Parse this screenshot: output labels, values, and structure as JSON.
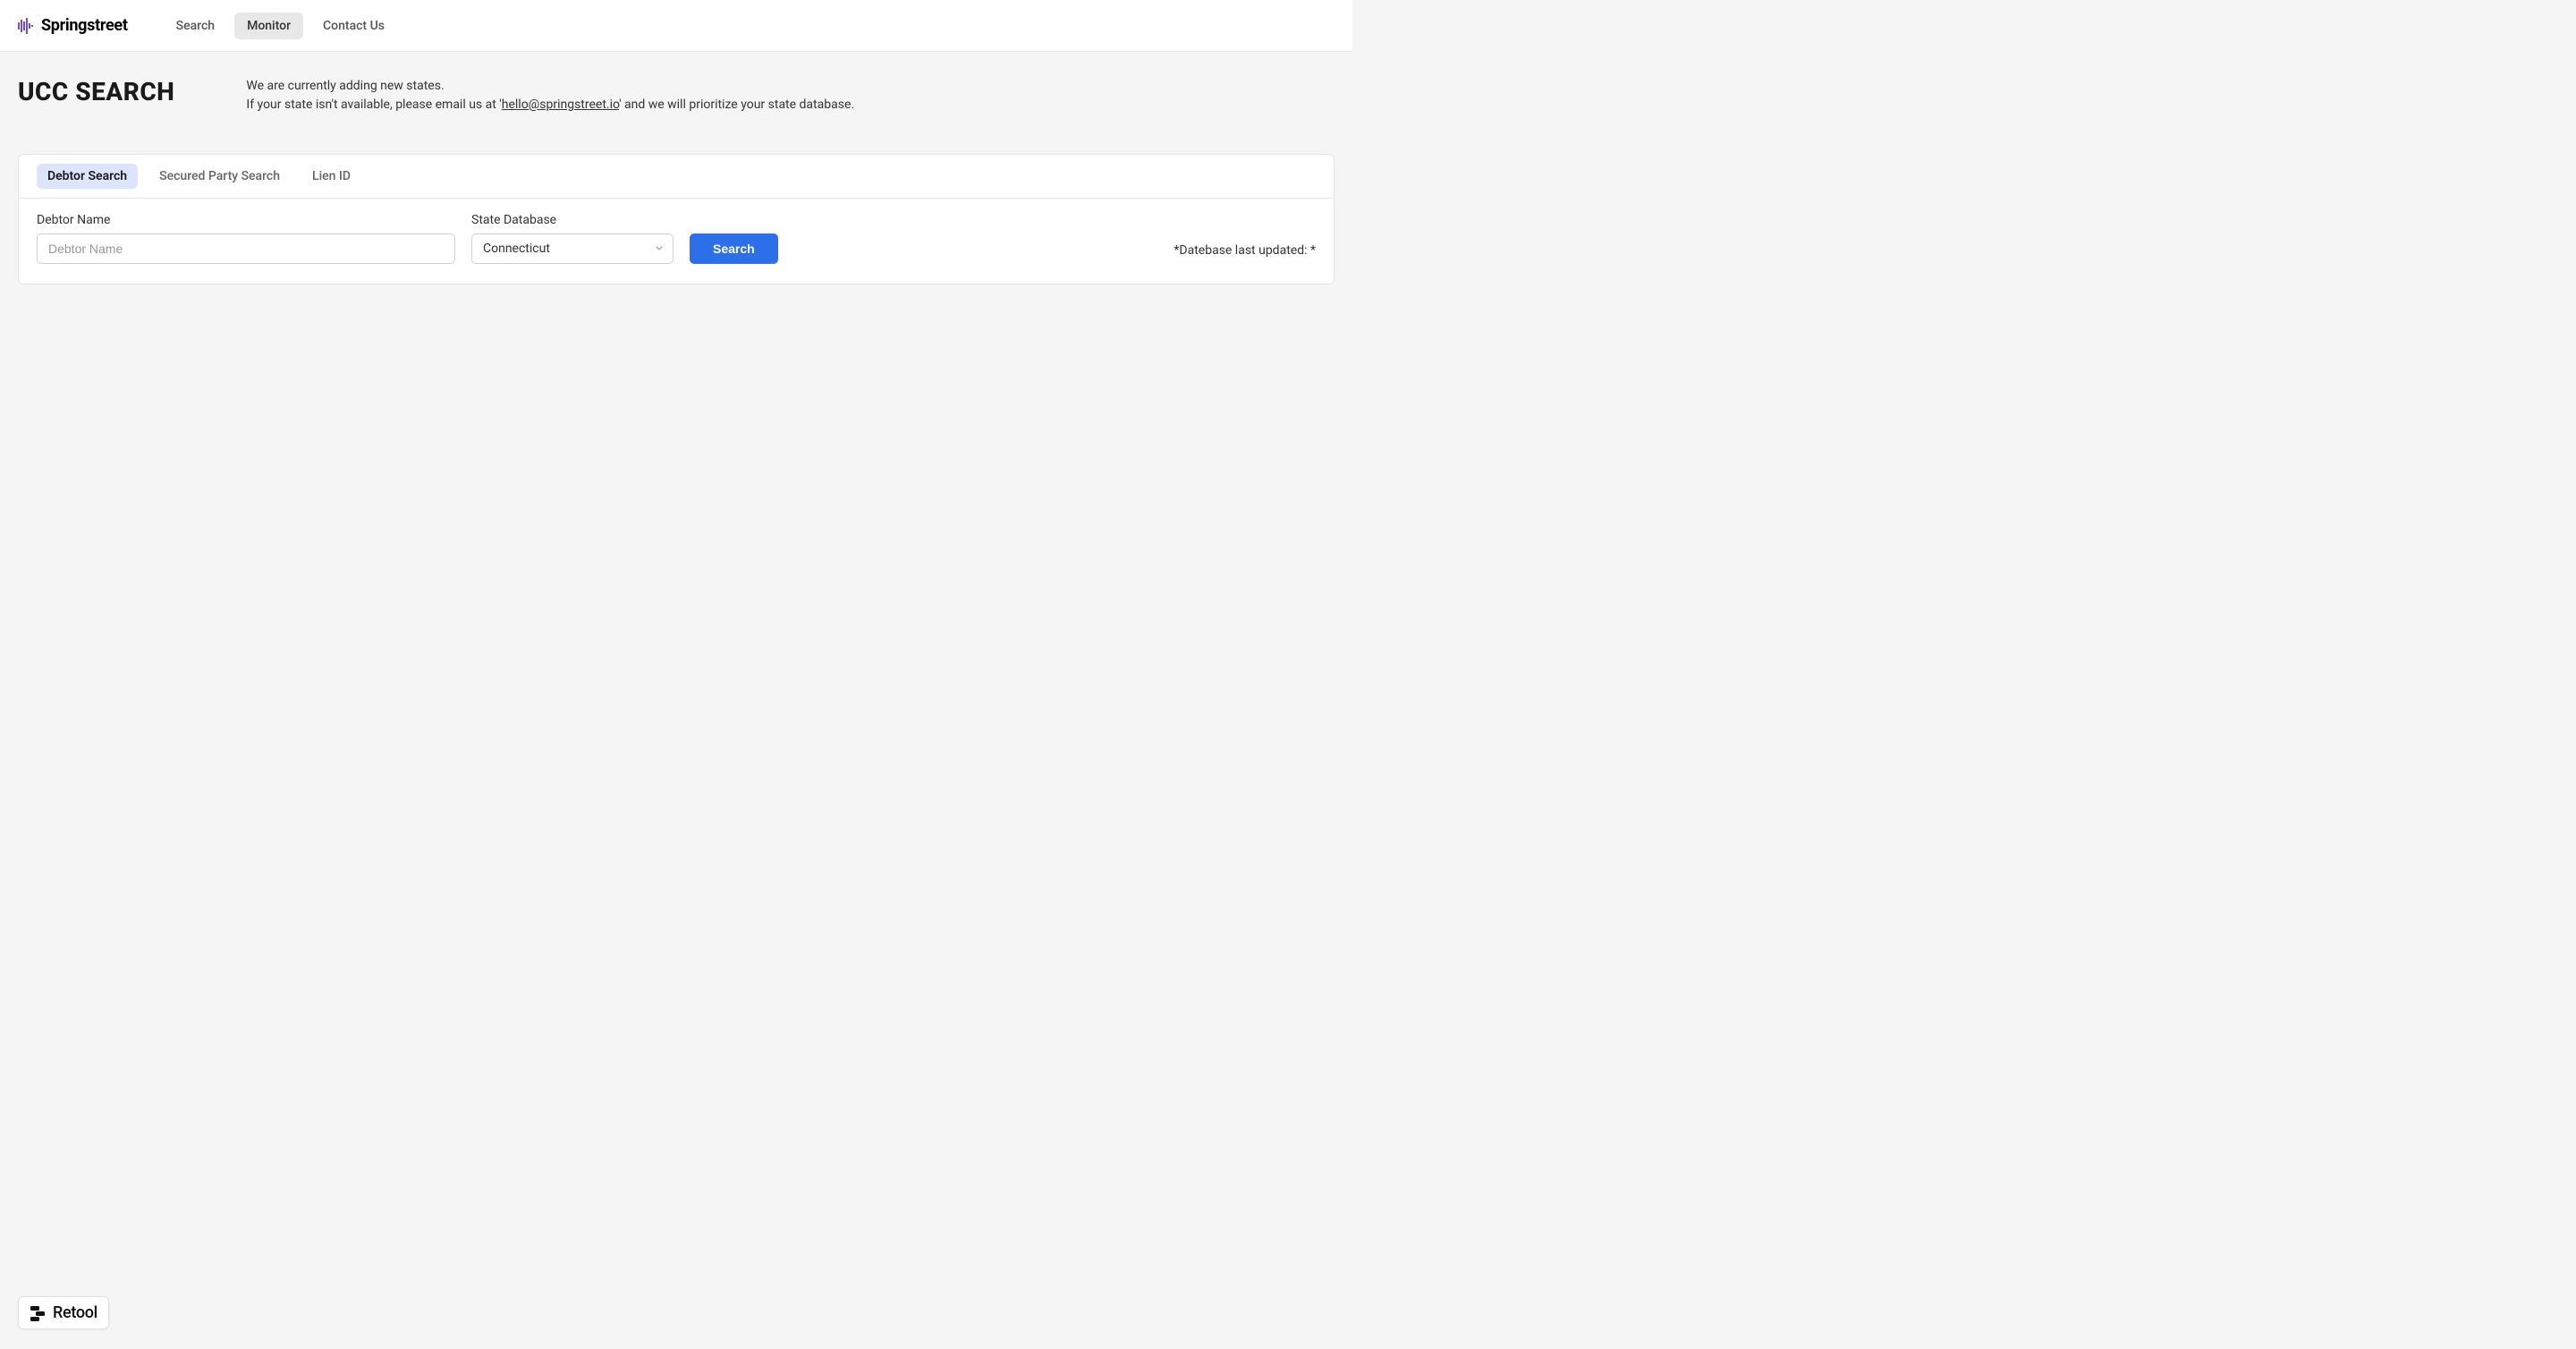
{
  "brand": {
    "name": "Springstreet"
  },
  "nav": {
    "items": [
      {
        "label": "Search",
        "active": false
      },
      {
        "label": "Monitor",
        "active": true
      },
      {
        "label": "Contact Us",
        "active": false
      }
    ]
  },
  "page": {
    "title": "UCC SEARCH",
    "description_line1": "We are currently adding new states.",
    "description_prefix": "If your state isn't available, please email us at '",
    "description_email": "hello@springstreet.io",
    "description_suffix": "' and we will prioritize your state database."
  },
  "tabs": [
    {
      "label": "Debtor Search",
      "active": true
    },
    {
      "label": "Secured Party Search",
      "active": false
    },
    {
      "label": "Lien ID",
      "active": false
    }
  ],
  "form": {
    "debtor_name": {
      "label": "Debtor Name",
      "placeholder": "Debtor Name",
      "value": ""
    },
    "state_database": {
      "label": "State Database",
      "selected": "Connecticut"
    },
    "search_button": "Search",
    "last_updated_label": "*Datebase last updated: *"
  },
  "footer": {
    "retool": "Retool"
  }
}
